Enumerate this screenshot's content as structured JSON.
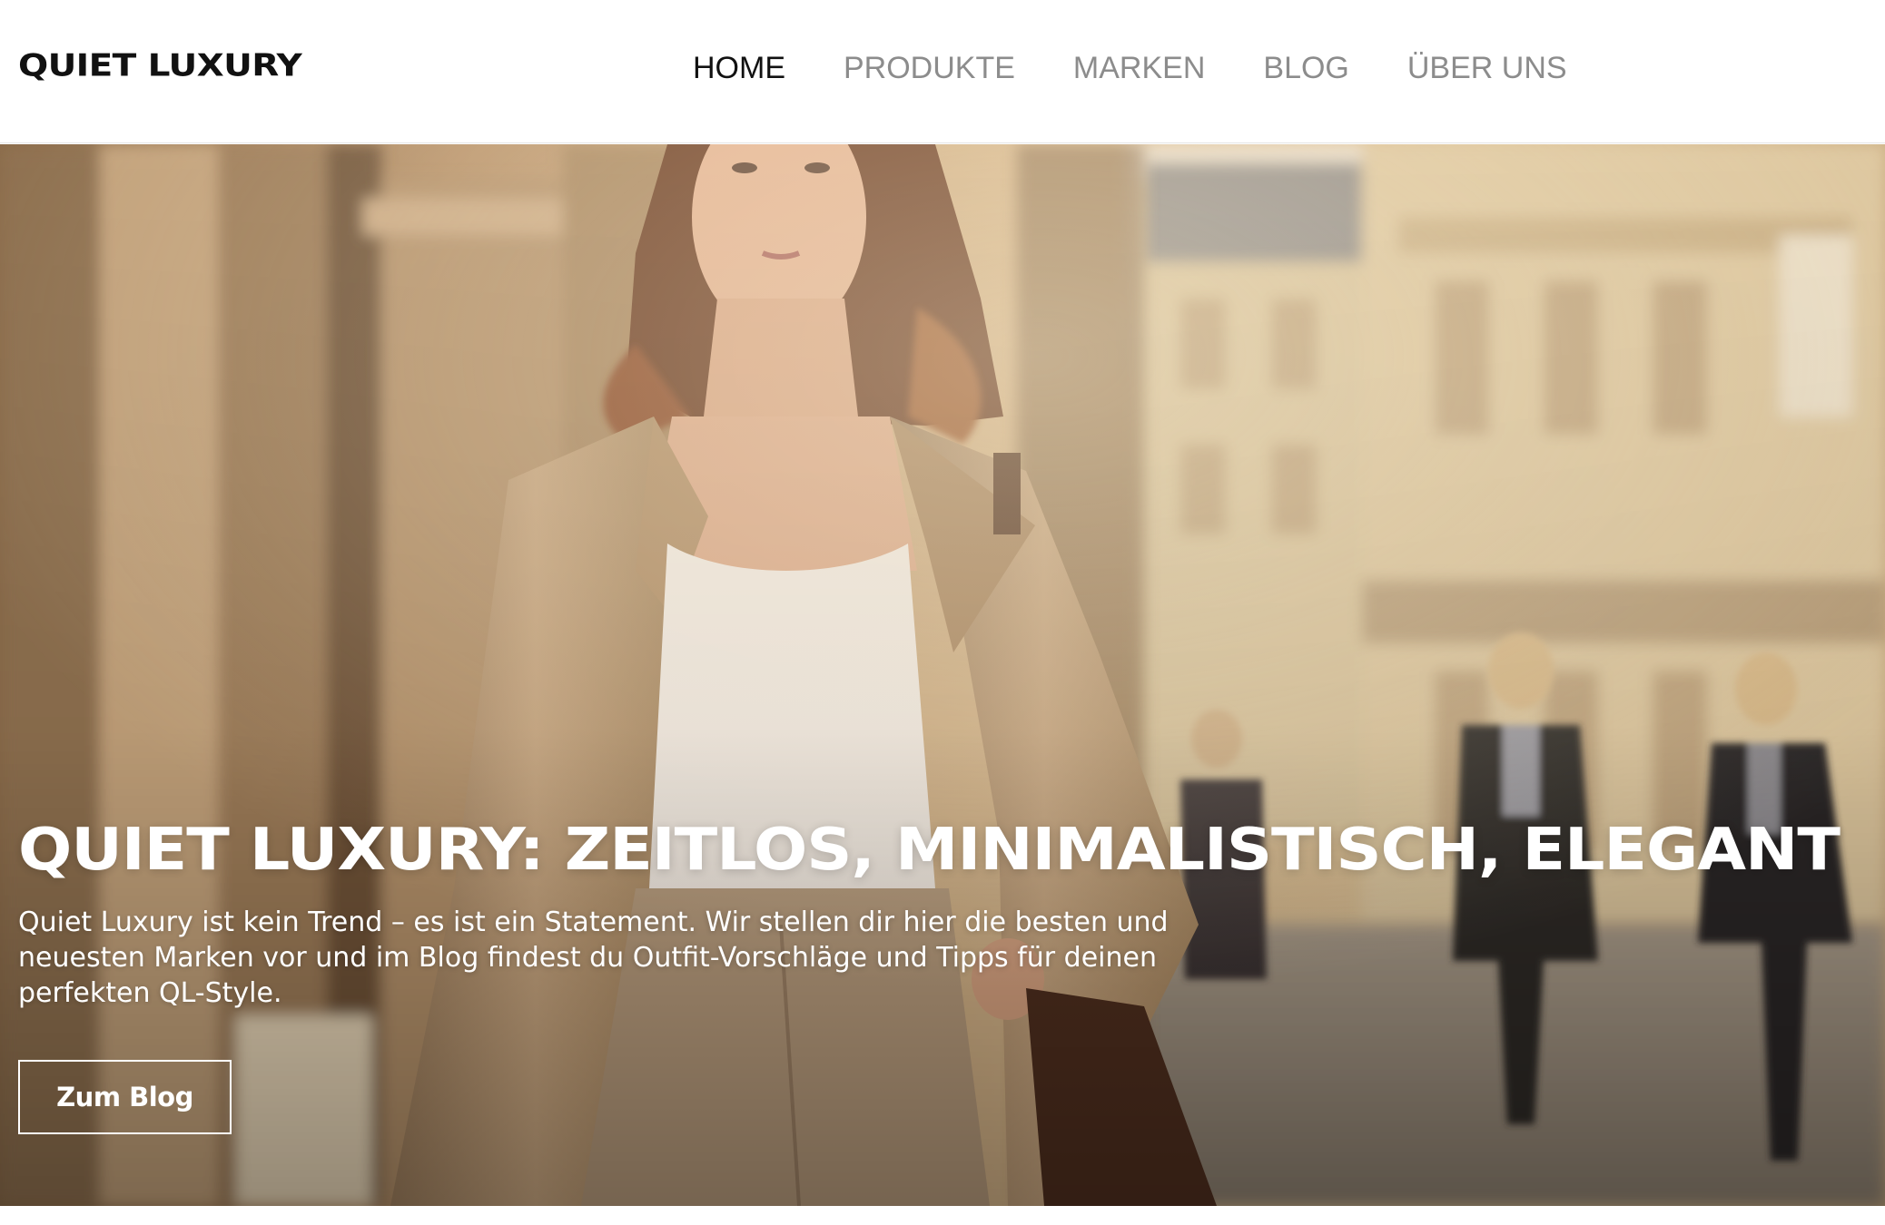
{
  "header": {
    "logo": "QUIET LUXURY",
    "nav": [
      {
        "label": "HOME",
        "active": true
      },
      {
        "label": "PRODUKTE",
        "active": false
      },
      {
        "label": "MARKEN",
        "active": false
      },
      {
        "label": "BLOG",
        "active": false
      },
      {
        "label": "ÜBER UNS",
        "active": false
      }
    ]
  },
  "hero": {
    "title": "QUIET LUXURY: ZEITLOS, MINIMALISTISCH, ELEGANT",
    "text": "Quiet Luxury ist kein Trend – es ist ein Statement. Wir stellen dir hier die besten und neuesten Marken vor und im Blog findest du Outfit-Vorschläge und Tipps für deinen perfekten QL-Style.",
    "button_label": "Zum Blog"
  },
  "colors": {
    "nav_active": "#111111",
    "nav_inactive": "#8c8c8c",
    "hero_text": "#ffffff"
  }
}
